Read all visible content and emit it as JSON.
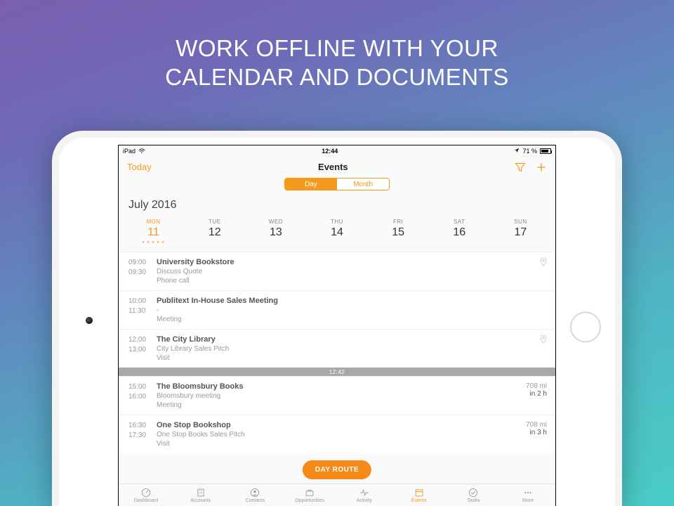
{
  "hero": {
    "line1": "WORK OFFLINE WITH YOUR",
    "line2": "CALENDAR AND DOCUMENTS"
  },
  "statusbar": {
    "device": "iPad",
    "time": "12:44",
    "battery": "71 %"
  },
  "nav": {
    "today": "Today",
    "title": "Events",
    "segments": {
      "day": "Day",
      "month": "Month"
    }
  },
  "calendar": {
    "month_label": "July 2016",
    "days": [
      {
        "dow": "MON",
        "num": "11",
        "selected": true,
        "dots": "• • • • •"
      },
      {
        "dow": "TUE",
        "num": "12"
      },
      {
        "dow": "WED",
        "num": "13"
      },
      {
        "dow": "THU",
        "num": "14"
      },
      {
        "dow": "FRI",
        "num": "15"
      },
      {
        "dow": "SAT",
        "num": "16"
      },
      {
        "dow": "SUN",
        "num": "17"
      }
    ]
  },
  "now_time": "12:42",
  "events_before": [
    {
      "start": "09:00",
      "end": "09:30",
      "title": "University Bookstore",
      "subtitle": "Discuss Quote",
      "type": "Phone call",
      "pin": true
    },
    {
      "start": "10:00",
      "end": "11:30",
      "title": "Publitext In-House Sales Meeting",
      "subtitle": "-",
      "type": "Meeting"
    },
    {
      "start": "12:00",
      "end": "13:00",
      "title": "The City Library",
      "subtitle": "City Library Sales Pitch",
      "type": "Visit",
      "pin": true
    }
  ],
  "events_after": [
    {
      "start": "15:00",
      "end": "16:00",
      "title": "The Bloomsbury Books",
      "subtitle": "Bloomsbury meeting",
      "type": "Meeting",
      "dist": "708 mi",
      "eta": "in 2 h"
    },
    {
      "start": "16:30",
      "end": "17:30",
      "title": "One Stop Bookshop",
      "subtitle": "One Stop Books Sales Pitch",
      "type": "Visit",
      "dist": "708 mi",
      "eta": "in 3 h"
    }
  ],
  "day_route_label": "DAY ROUTE",
  "tabs": [
    {
      "label": "Dashboard",
      "icon": "gauge-icon"
    },
    {
      "label": "Accounts",
      "icon": "building-icon"
    },
    {
      "label": "Contacts",
      "icon": "person-icon"
    },
    {
      "label": "Opportunities",
      "icon": "briefcase-icon"
    },
    {
      "label": "Activity",
      "icon": "activity-icon"
    },
    {
      "label": "Events",
      "icon": "calendar-icon",
      "active": true
    },
    {
      "label": "Tasks",
      "icon": "check-icon"
    },
    {
      "label": "More",
      "icon": "more-icon"
    }
  ],
  "colors": {
    "accent": "#f39a1c"
  }
}
